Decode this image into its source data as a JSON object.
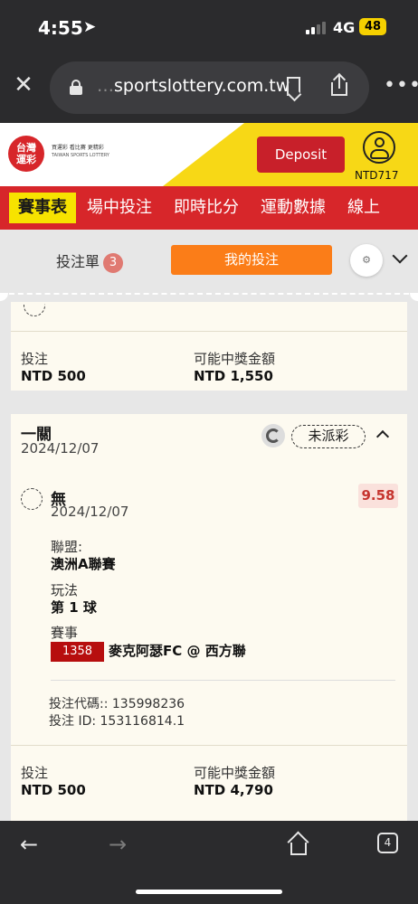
{
  "status_bar": {
    "time": "4:55",
    "network": "4G",
    "battery": "48"
  },
  "browser": {
    "url_faded": "…",
    "url": "sportslottery.com.tw"
  },
  "site_header": {
    "logo_lines": [
      "台灣",
      "運彩"
    ],
    "tagline": "買運彩 看比賽 更精彩",
    "tagline_en": "TAIWAN SPORTS LOTTERY",
    "deposit_label": "Deposit",
    "balance": "NTD717"
  },
  "nav": {
    "items": [
      "賽事表",
      "場中投注",
      "即時比分",
      "運動數據",
      "線上"
    ]
  },
  "betslip_bar": {
    "tab_betslip": "投注單",
    "betslip_count": "3",
    "tab_my_bets": "我的投注"
  },
  "bet_card_1": {
    "stake_label": "投注",
    "stake_value": "NTD 500",
    "payout_label": "可能中獎金額",
    "payout_value": "NTD 1,550"
  },
  "bet_card_2": {
    "title": "一關",
    "date": "2024/12/07",
    "status": "未派彩",
    "selection_name": "無",
    "selection_date": "2024/12/07",
    "odds": "9.58",
    "league_label": "聯盟:",
    "league_value": "澳洲A聯賽",
    "market_label": "玩法",
    "market_value": "第 1 球",
    "event_label": "賽事",
    "event_id": "1358",
    "event_name": "麥克阿瑟FC @ 西方聯",
    "bet_code": "投注代碼:: 135998236",
    "bet_id": "投注 ID: 153116814.1",
    "stake_label": "投注",
    "stake_value": "NTD 500",
    "payout_label": "可能中獎金額",
    "payout_value": "NTD 4,790"
  },
  "toolbar": {
    "tab_count": "4"
  }
}
